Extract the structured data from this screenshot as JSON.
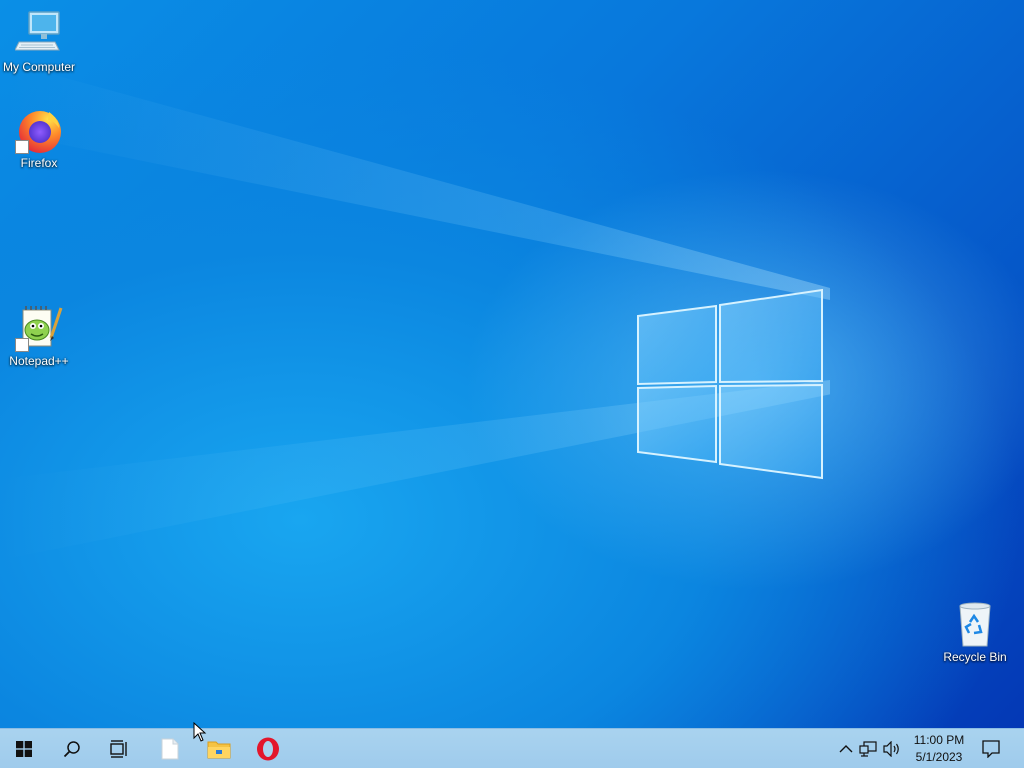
{
  "desktop_icons": {
    "my_computer": "My Computer",
    "firefox": "Firefox",
    "notepadpp": "Notepad++",
    "recycle_bin": "Recycle Bin"
  },
  "taskbar": {
    "start_icon": "windows-logo-icon",
    "search_icon": "search-icon",
    "task_view_icon": "task-view-icon",
    "pinned": [
      "blank-document-icon",
      "file-explorer-icon",
      "opera-icon"
    ]
  },
  "tray": {
    "time": "11:00 PM",
    "date": "5/1/2023",
    "icons": [
      "chevron-up-icon",
      "network-icon",
      "volume-icon",
      "notification-icon"
    ]
  },
  "colors": {
    "wallpaper_accent": "#0a8fe6",
    "taskbar": "#a9d3ef",
    "opera_red": "#e3162b",
    "explorer_yellow": "#f5c342"
  }
}
